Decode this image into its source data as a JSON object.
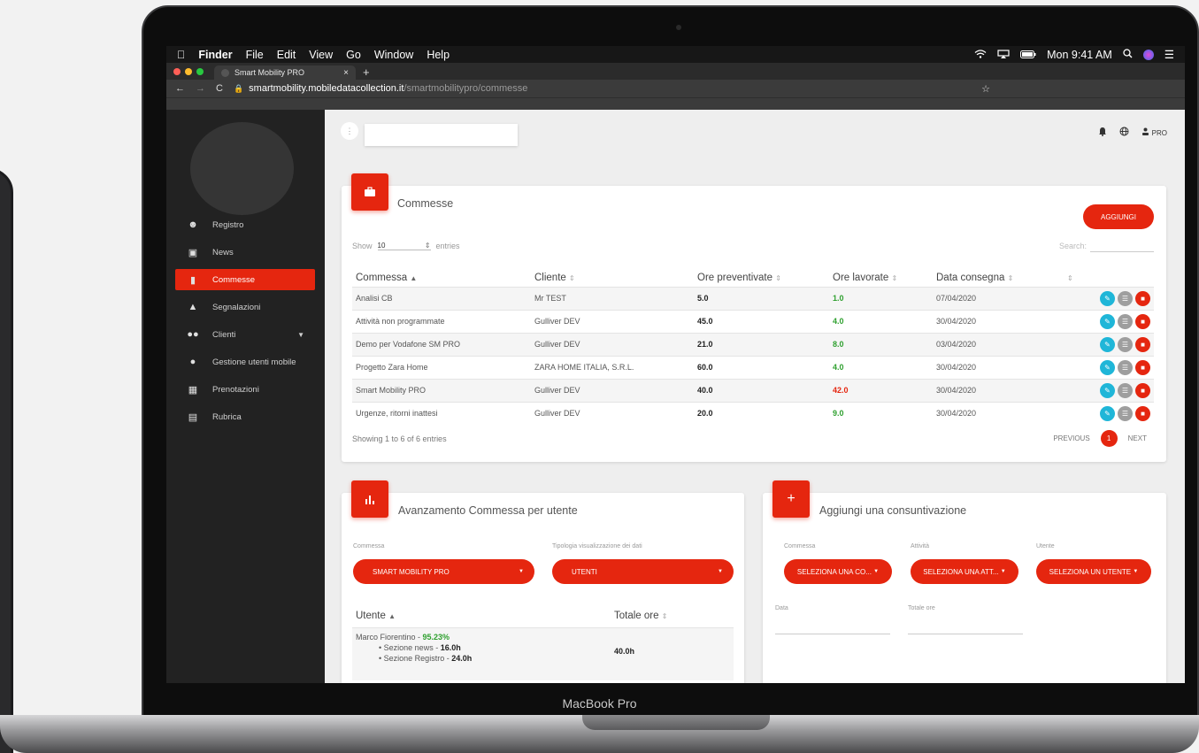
{
  "menubar": {
    "app": "Finder",
    "items": [
      "File",
      "Edit",
      "View",
      "Go",
      "Window",
      "Help"
    ],
    "clock": "Mon 9:41 AM"
  },
  "browser": {
    "tab_title": "Smart Mobility PRO",
    "url_host": "smartmobility.mobiledatacollection.it",
    "url_path": "/smartmobilitypro/commesse"
  },
  "sidebar": {
    "items": [
      {
        "label": "Registro",
        "icon": "person-check-icon"
      },
      {
        "label": "News",
        "icon": "document-icon"
      },
      {
        "label": "Commesse",
        "icon": "bookmark-icon",
        "active": true
      },
      {
        "label": "Segnalazioni",
        "icon": "warning-icon"
      },
      {
        "label": "Clienti",
        "icon": "people-icon"
      },
      {
        "label": "Gestione utenti mobile",
        "icon": "person-icon"
      },
      {
        "label": "Prenotazioni",
        "icon": "book-icon"
      },
      {
        "label": "Rubrica",
        "icon": "contacts-icon"
      }
    ]
  },
  "topbar": {
    "user_label": "PRO"
  },
  "commesse": {
    "title": "Commesse",
    "add_label": "AGGIUNGI",
    "show_label": "Show",
    "show_value": "10",
    "entries_label": "entries",
    "search_label": "Search:",
    "columns": [
      "Commessa",
      "Cliente",
      "Ore preventivate",
      "Ore lavorate",
      "Data consegna"
    ],
    "rows": [
      {
        "commessa": "Analisi CB",
        "cliente": "Mr TEST",
        "ore_prev": "5.0",
        "ore_lav": "1.0",
        "over": false,
        "data": "07/04/2020"
      },
      {
        "commessa": "Attività non programmate",
        "cliente": "Gulliver DEV",
        "ore_prev": "45.0",
        "ore_lav": "4.0",
        "over": false,
        "data": "30/04/2020"
      },
      {
        "commessa": "Demo per Vodafone SM PRO",
        "cliente": "Gulliver DEV",
        "ore_prev": "21.0",
        "ore_lav": "8.0",
        "over": false,
        "data": "03/04/2020"
      },
      {
        "commessa": "Progetto Zara Home",
        "cliente": "ZARA HOME ITALIA, S.R.L.",
        "ore_prev": "60.0",
        "ore_lav": "4.0",
        "over": false,
        "data": "30/04/2020"
      },
      {
        "commessa": "Smart Mobility PRO",
        "cliente": "Gulliver DEV",
        "ore_prev": "40.0",
        "ore_lav": "42.0",
        "over": true,
        "data": "30/04/2020"
      },
      {
        "commessa": "Urgenze, ritorni inattesi",
        "cliente": "Gulliver DEV",
        "ore_prev": "20.0",
        "ore_lav": "9.0",
        "over": false,
        "data": "30/04/2020"
      }
    ],
    "showing": "Showing 1 to 6 of 6 entries",
    "previous": "PREVIOUS",
    "page": "1",
    "next": "NEXT"
  },
  "avanzamento": {
    "title": "Avanzamento Commessa per utente",
    "commessa_label": "Commessa",
    "commessa_value": "SMART MOBILITY PRO",
    "tipologia_label": "Tipologia visualizzazione dei dati",
    "tipologia_value": "UTENTI",
    "col_utente": "Utente",
    "col_totale": "Totale ore",
    "user_name": "Marco Fiorentino",
    "user_pct": "95.23%",
    "sub1_label": "Sezione news",
    "sub1_value": "16.0h",
    "sub2_label": "Sezione Registro",
    "sub2_value": "24.0h",
    "total": "40.0h"
  },
  "consuntivazione": {
    "title": "Aggiungi una consuntivazione",
    "commessa_label": "Commessa",
    "commessa_value": "SELEZIONA UNA CO...",
    "attivita_label": "Attività",
    "attivita_value": "SELEZIONA UNA ATT...",
    "utente_label": "Utente",
    "utente_value": "SELEZIONA UN UTENTE",
    "data_label": "Data",
    "totale_label": "Totale ore"
  },
  "device": {
    "label": "MacBook Pro"
  },
  "colors": {
    "accent": "#e5260f",
    "green": "#2fa02f",
    "edit": "#1fb6d8",
    "doc": "#9e9e9e"
  }
}
